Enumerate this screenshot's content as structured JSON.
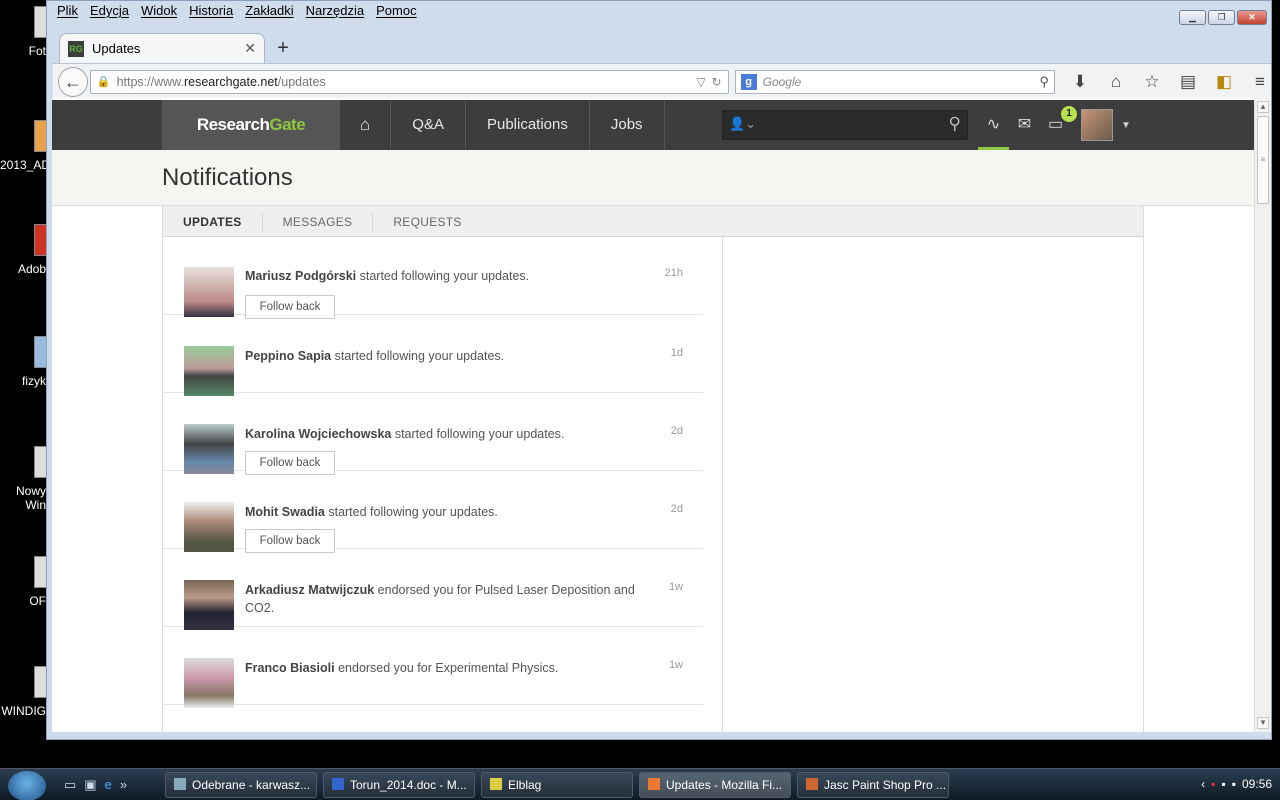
{
  "desktop": {
    "icons": [
      {
        "label": "Fot"
      },
      {
        "label": "2013_AD"
      },
      {
        "label": "Adob"
      },
      {
        "label": "fizyk"
      },
      {
        "label": "Nowy"
      },
      {
        "label": "Win"
      },
      {
        "label": "OF"
      },
      {
        "label": "WINDIG"
      }
    ]
  },
  "browser": {
    "menu": [
      "Plik",
      "Edycja",
      "Widok",
      "Historia",
      "Zakładki",
      "Narzędzia",
      "Pomoc"
    ],
    "tab_title": "Updates",
    "tab_favicon": "RG",
    "url_prefix": "https://www.",
    "url_domain": "researchgate.net",
    "url_path": "/updates",
    "search_placeholder": "Google"
  },
  "rg": {
    "logo_main": "Research",
    "logo_accent": "Gate",
    "nav": [
      "Q&A",
      "Publications",
      "Jobs"
    ],
    "badge_count": "1"
  },
  "page": {
    "title": "Notifications",
    "tabs": [
      "UPDATES",
      "MESSAGES",
      "REQUESTS"
    ],
    "follow_back_label": "Follow back",
    "items": [
      {
        "name": "Mariusz Podgórski",
        "action": " started following your updates.",
        "time": "21h",
        "follow_back": true
      },
      {
        "name": "Peppino Sapia",
        "action": " started following your updates.",
        "time": "1d",
        "follow_back": false
      },
      {
        "name": "Karolina Wojciechowska",
        "action": " started following your updates.",
        "time": "2d",
        "follow_back": true
      },
      {
        "name": "Mohit Swadia",
        "action": " started following your updates.",
        "time": "2d",
        "follow_back": true
      },
      {
        "name": "Arkadiusz Matwijczuk",
        "action": " endorsed you for Pulsed Laser Deposition and CO2.",
        "time": "1w",
        "follow_back": false
      },
      {
        "name": "Franco Biasioli",
        "action": " endorsed you for Experimental Physics.",
        "time": "1w",
        "follow_back": false
      }
    ]
  },
  "taskbar": {
    "tasks": [
      {
        "label": "Odebrane - karwasz..."
      },
      {
        "label": "Torun_2014.doc - M..."
      },
      {
        "label": "Elblag"
      },
      {
        "label": "Updates - Mozilla Fi..."
      },
      {
        "label": "Jasc Paint Shop Pro ..."
      }
    ],
    "clock": "09:56"
  },
  "colors": {
    "rg_green": "#8dc63f",
    "rg_dark": "#3d3d3d",
    "badge": "#b7e14f"
  }
}
